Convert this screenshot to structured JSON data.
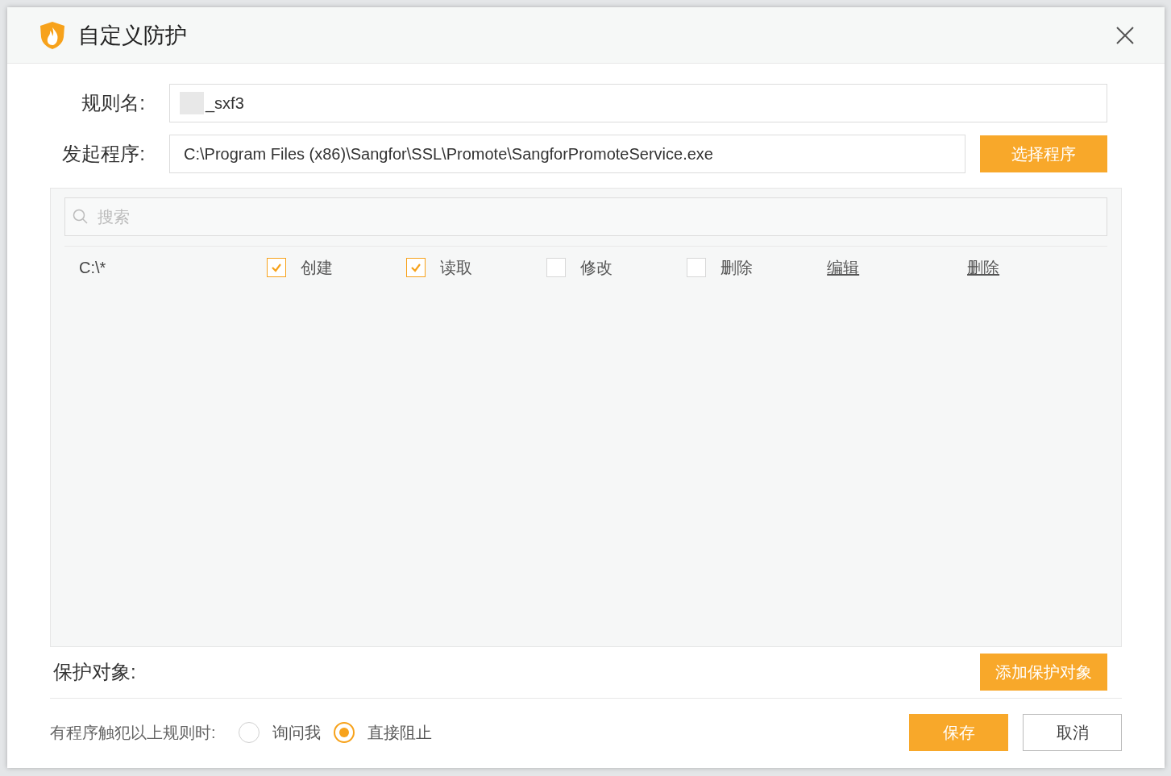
{
  "window": {
    "title": "自定义防护"
  },
  "rule_name": {
    "label": "规则名:",
    "value": "_sxf3",
    "redacted": true
  },
  "launcher": {
    "label": "发起程序:",
    "value": "C:\\Program Files (x86)\\Sangfor\\SSL\\Promote\\SangforPromoteService.exe",
    "button": "选择程序"
  },
  "search": {
    "placeholder": "搜索"
  },
  "rows": [
    {
      "path": "C:\\*",
      "permissions": [
        {
          "label": "创建",
          "checked": true
        },
        {
          "label": "读取",
          "checked": true
        },
        {
          "label": "修改",
          "checked": false
        },
        {
          "label": "删除",
          "checked": false
        }
      ],
      "actions": [
        "编辑",
        "删除"
      ]
    }
  ],
  "protected_objects": {
    "label": "保护对象:",
    "button": "添加保护对象"
  },
  "on_violation": {
    "label": "有程序触犯以上规则时:",
    "options": [
      {
        "label": "询问我",
        "selected": false
      },
      {
        "label": "直接阻止",
        "selected": true
      }
    ]
  },
  "buttons": [
    {
      "label": "保存",
      "kind": "primary"
    },
    {
      "label": "取消",
      "kind": "secondary"
    }
  ]
}
